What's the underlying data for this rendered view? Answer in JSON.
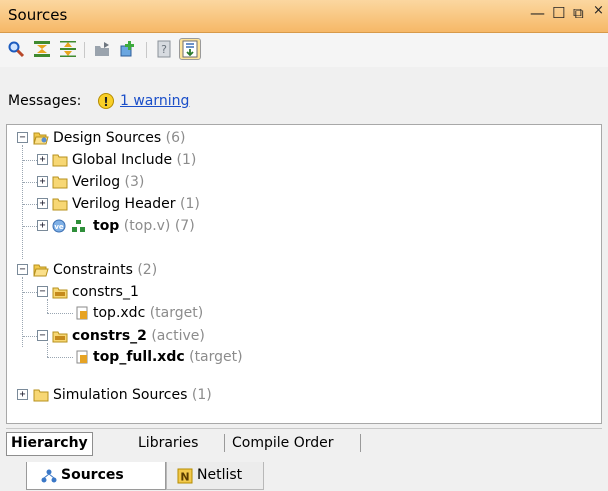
{
  "window": {
    "title": "Sources",
    "minimize": "—",
    "maximize": "☐",
    "restore": "⧉",
    "close": "×"
  },
  "toolbar": {
    "icons": [
      "search-icon",
      "collapse-all-icon",
      "expand-all-icon",
      "add-file-icon",
      "add-sources-icon",
      "properties-icon",
      "show-hierarchy-icon"
    ]
  },
  "messages": {
    "label": "Messages:",
    "warning_icon": "!",
    "warning_link": "1 warning"
  },
  "tree": {
    "design_sources": {
      "label": "Design Sources",
      "count": "(6)"
    },
    "global_include": {
      "label": "Global Include",
      "count": "(1)"
    },
    "verilog": {
      "label": "Verilog",
      "count": "(3)"
    },
    "verilog_header": {
      "label": "Verilog Header",
      "count": "(1)"
    },
    "top": {
      "label": "top",
      "suffix": "(top.v) (7)"
    },
    "constraints": {
      "label": "Constraints",
      "count": "(2)"
    },
    "constrs_1": {
      "label": "constrs_1"
    },
    "top_xdc": {
      "label": "top.xdc",
      "suffix": "(target)"
    },
    "constrs_2": {
      "label": "constrs_2",
      "suffix": "(active)"
    },
    "top_full_xdc": {
      "label": "top_full.xdc",
      "suffix": "(target)"
    },
    "simulation_sources": {
      "label": "Simulation Sources",
      "count": "(1)"
    },
    "expand_plus": "+",
    "expand_minus": "−"
  },
  "view_tabs": [
    "Hierarchy",
    "Libraries",
    "Compile Order"
  ],
  "bottom_tabs": [
    "Sources",
    "Netlist"
  ],
  "colors": {
    "title_bar": "#f6b867",
    "link": "#1b4fc9",
    "folder": "#f2c94c",
    "count_gray": "#8c8c8c"
  }
}
